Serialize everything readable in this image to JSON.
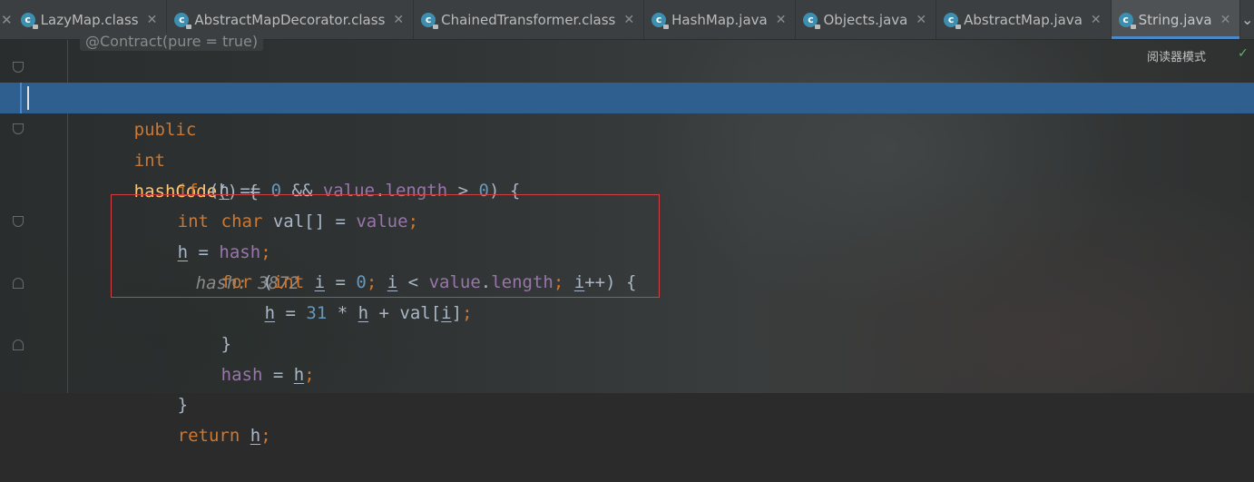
{
  "tabs": [
    {
      "label": "LazyMap.class",
      "active": false,
      "icon": "class-icon"
    },
    {
      "label": "AbstractMapDecorator.class",
      "active": false,
      "icon": "class-icon"
    },
    {
      "label": "ChainedTransformer.class",
      "active": false,
      "icon": "class-icon"
    },
    {
      "label": "HashMap.java",
      "active": false,
      "icon": "class-icon"
    },
    {
      "label": "Objects.java",
      "active": false,
      "icon": "class-icon"
    },
    {
      "label": "AbstractMap.java",
      "active": false,
      "icon": "class-icon"
    },
    {
      "label": "String.java",
      "active": true,
      "icon": "class-icon"
    }
  ],
  "toolbar": {
    "reader_mode_label": "阅读器模式"
  },
  "annotation": "@Contract(pure = true)",
  "code": {
    "l1": {
      "kw1": "public",
      "kw2": "int",
      "fn": "hashCode",
      "rest": "() {"
    },
    "l2": {
      "kw": "int",
      "var": "h",
      "eq": " = ",
      "fld": "hash",
      "semi": ";",
      "hint": "hash: 3872"
    },
    "l3": {
      "kw": "if",
      "p1": " (",
      "var": "h",
      "p2": " == ",
      "n0": "0",
      "p3": " && ",
      "fld": "value",
      "p4": ".",
      "fld2": "length",
      "p5": " > ",
      "n1": "0",
      "p6": ") {"
    },
    "l4": {
      "kw": "char",
      "p1": " val[] = ",
      "fld": "value",
      "semi": ";"
    },
    "l6": {
      "kw": "for",
      "p1": " (",
      "kw2": "int",
      "p2": " ",
      "i1": "i",
      "p3": " = ",
      "n0": "0",
      "semi1": ";",
      "p4": " ",
      "i2": "i",
      "p5": " < ",
      "fld": "value",
      "p6": ".",
      "fld2": "length",
      "semi2": ";",
      "p7": " ",
      "i3": "i",
      "p8": "++) {"
    },
    "l7": {
      "h1": "h",
      "p1": " = ",
      "n": "31",
      "p2": " * ",
      "h2": "h",
      "p3": " + val[",
      "i": "i",
      "p4": "]",
      "semi": ";"
    },
    "l8": {
      "brace": "}"
    },
    "l9": {
      "fld": "hash",
      "p1": " = ",
      "h": "h",
      "semi": ";"
    },
    "l10": {
      "brace": "}"
    },
    "l11": {
      "kw": "return",
      "p1": " ",
      "h": "h",
      "semi": ";"
    }
  }
}
